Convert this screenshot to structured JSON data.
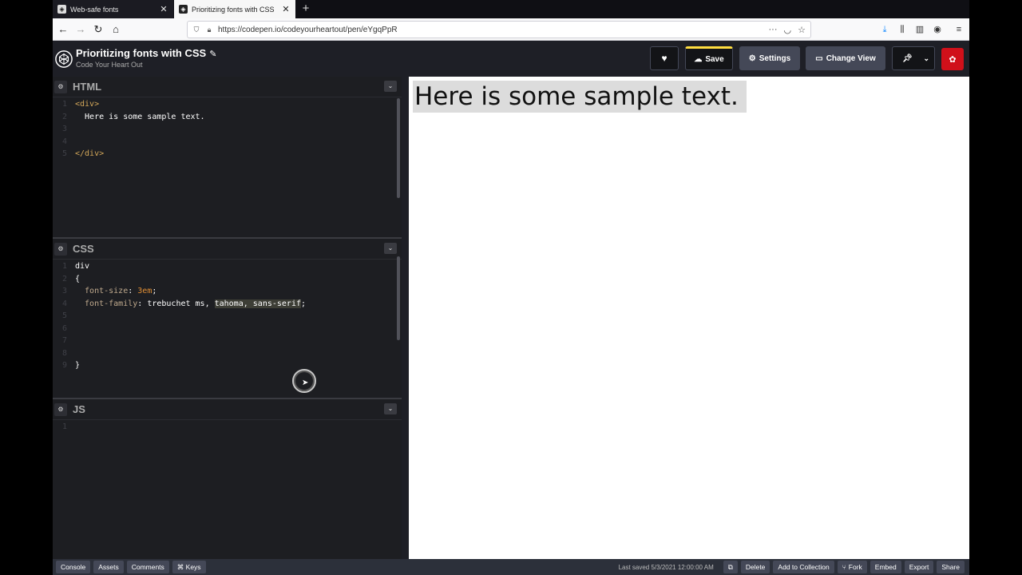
{
  "browser": {
    "tabs": [
      {
        "title": "Web-safe fonts",
        "active": false
      },
      {
        "title": "Prioritizing fonts with CSS",
        "active": true
      }
    ],
    "url": "https://codepen.io/codeyourheartout/pen/eYgqPpR",
    "url_more": "···"
  },
  "codepen": {
    "pen_title": "Prioritizing fonts with CSS",
    "author": "Code Your Heart Out",
    "buttons": {
      "save": "Save",
      "settings": "Settings",
      "change_view": "Change View"
    },
    "colors": {
      "save_accent": "#ffdd40",
      "header_bg": "#1e1f26",
      "avatar": "#d0101a"
    }
  },
  "editors": {
    "html": {
      "title": "HTML",
      "lines": [
        {
          "n": "1",
          "parts": [
            {
              "t": "<div>",
              "c": "tag"
            }
          ]
        },
        {
          "n": "2",
          "parts": [
            {
              "t": "  Here is some sample text.",
              "c": "text"
            }
          ]
        },
        {
          "n": "3",
          "parts": []
        },
        {
          "n": "4",
          "parts": []
        },
        {
          "n": "5",
          "parts": [
            {
              "t": "</div>",
              "c": "tag"
            }
          ]
        }
      ]
    },
    "css": {
      "title": "CSS",
      "lines": [
        {
          "n": "1",
          "parts": [
            {
              "t": "div",
              "c": "text"
            }
          ]
        },
        {
          "n": "2",
          "parts": [
            {
              "t": "{",
              "c": "text"
            }
          ]
        },
        {
          "n": "3",
          "parts": [
            {
              "t": "  font-size",
              "c": "prop"
            },
            {
              "t": ": ",
              "c": "text"
            },
            {
              "t": "3em",
              "c": "num"
            },
            {
              "t": ";",
              "c": "text"
            }
          ]
        },
        {
          "n": "4",
          "parts": [
            {
              "t": "  font-family",
              "c": "prop"
            },
            {
              "t": ": trebuchet ms, ",
              "c": "text"
            },
            {
              "t": "tahoma, sans-serif",
              "c": "hl"
            },
            {
              "t": ";",
              "c": "text"
            }
          ]
        },
        {
          "n": "5",
          "parts": []
        },
        {
          "n": "6",
          "parts": []
        },
        {
          "n": "7",
          "parts": []
        },
        {
          "n": "8",
          "parts": []
        },
        {
          "n": "9",
          "parts": [
            {
              "t": "}",
              "c": "text"
            }
          ]
        }
      ]
    },
    "js": {
      "title": "JS",
      "lines": [
        {
          "n": "1",
          "parts": []
        }
      ]
    }
  },
  "preview": {
    "text": "Here is some sample text."
  },
  "footer": {
    "left": [
      "Console",
      "Assets",
      "Comments",
      "⌘ Keys"
    ],
    "last_saved": "Last saved 5/3/2021 12:00:00 AM",
    "right": [
      "Delete",
      "Add to Collection",
      "Fork",
      "Embed",
      "Export",
      "Share"
    ]
  }
}
